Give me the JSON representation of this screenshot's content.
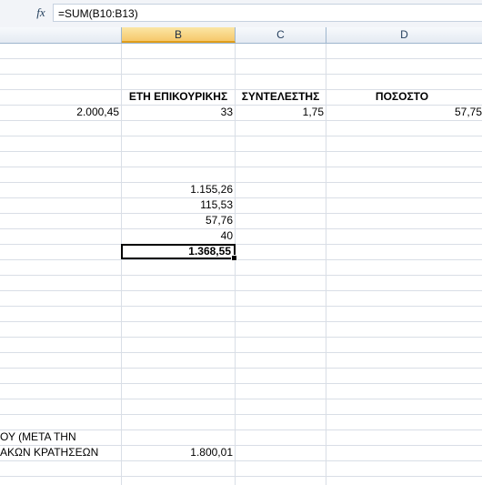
{
  "formula_bar": {
    "fx_label": "fx",
    "formula": "=SUM(B10:B13)"
  },
  "columns": [
    {
      "label": "B",
      "active": true
    },
    {
      "label": "C",
      "active": false
    },
    {
      "label": "D",
      "active": false
    }
  ],
  "cells": {
    "header_b": "ΕΤΗ ΕΠΙΚΟΥΡΙΚΗΣ",
    "header_c": "ΣΥΝΤΕΛΕΣΤΗΣ",
    "header_d": "ΠΟΣΟΣΤΟ",
    "row_a_left": "2.000,45",
    "row_a_b": "33",
    "row_a_c": "1,75",
    "row_a_d": "57,75",
    "b10": "1.155,26",
    "b11": "115,53",
    "b12": "57,76",
    "b13": "40",
    "b14": "1.368,55",
    "note_line1": "ΟΥ (ΜΕΤΑ ΤΗΝ",
    "note_line2": "ΑΚΩΝ ΚΡΑΤΗΣΕΩΝ",
    "note_value": "1.800,01"
  },
  "colors": {
    "active_header": "#f6c86b",
    "gridline": "#d9dee6",
    "header_border": "#9eb6ce"
  }
}
